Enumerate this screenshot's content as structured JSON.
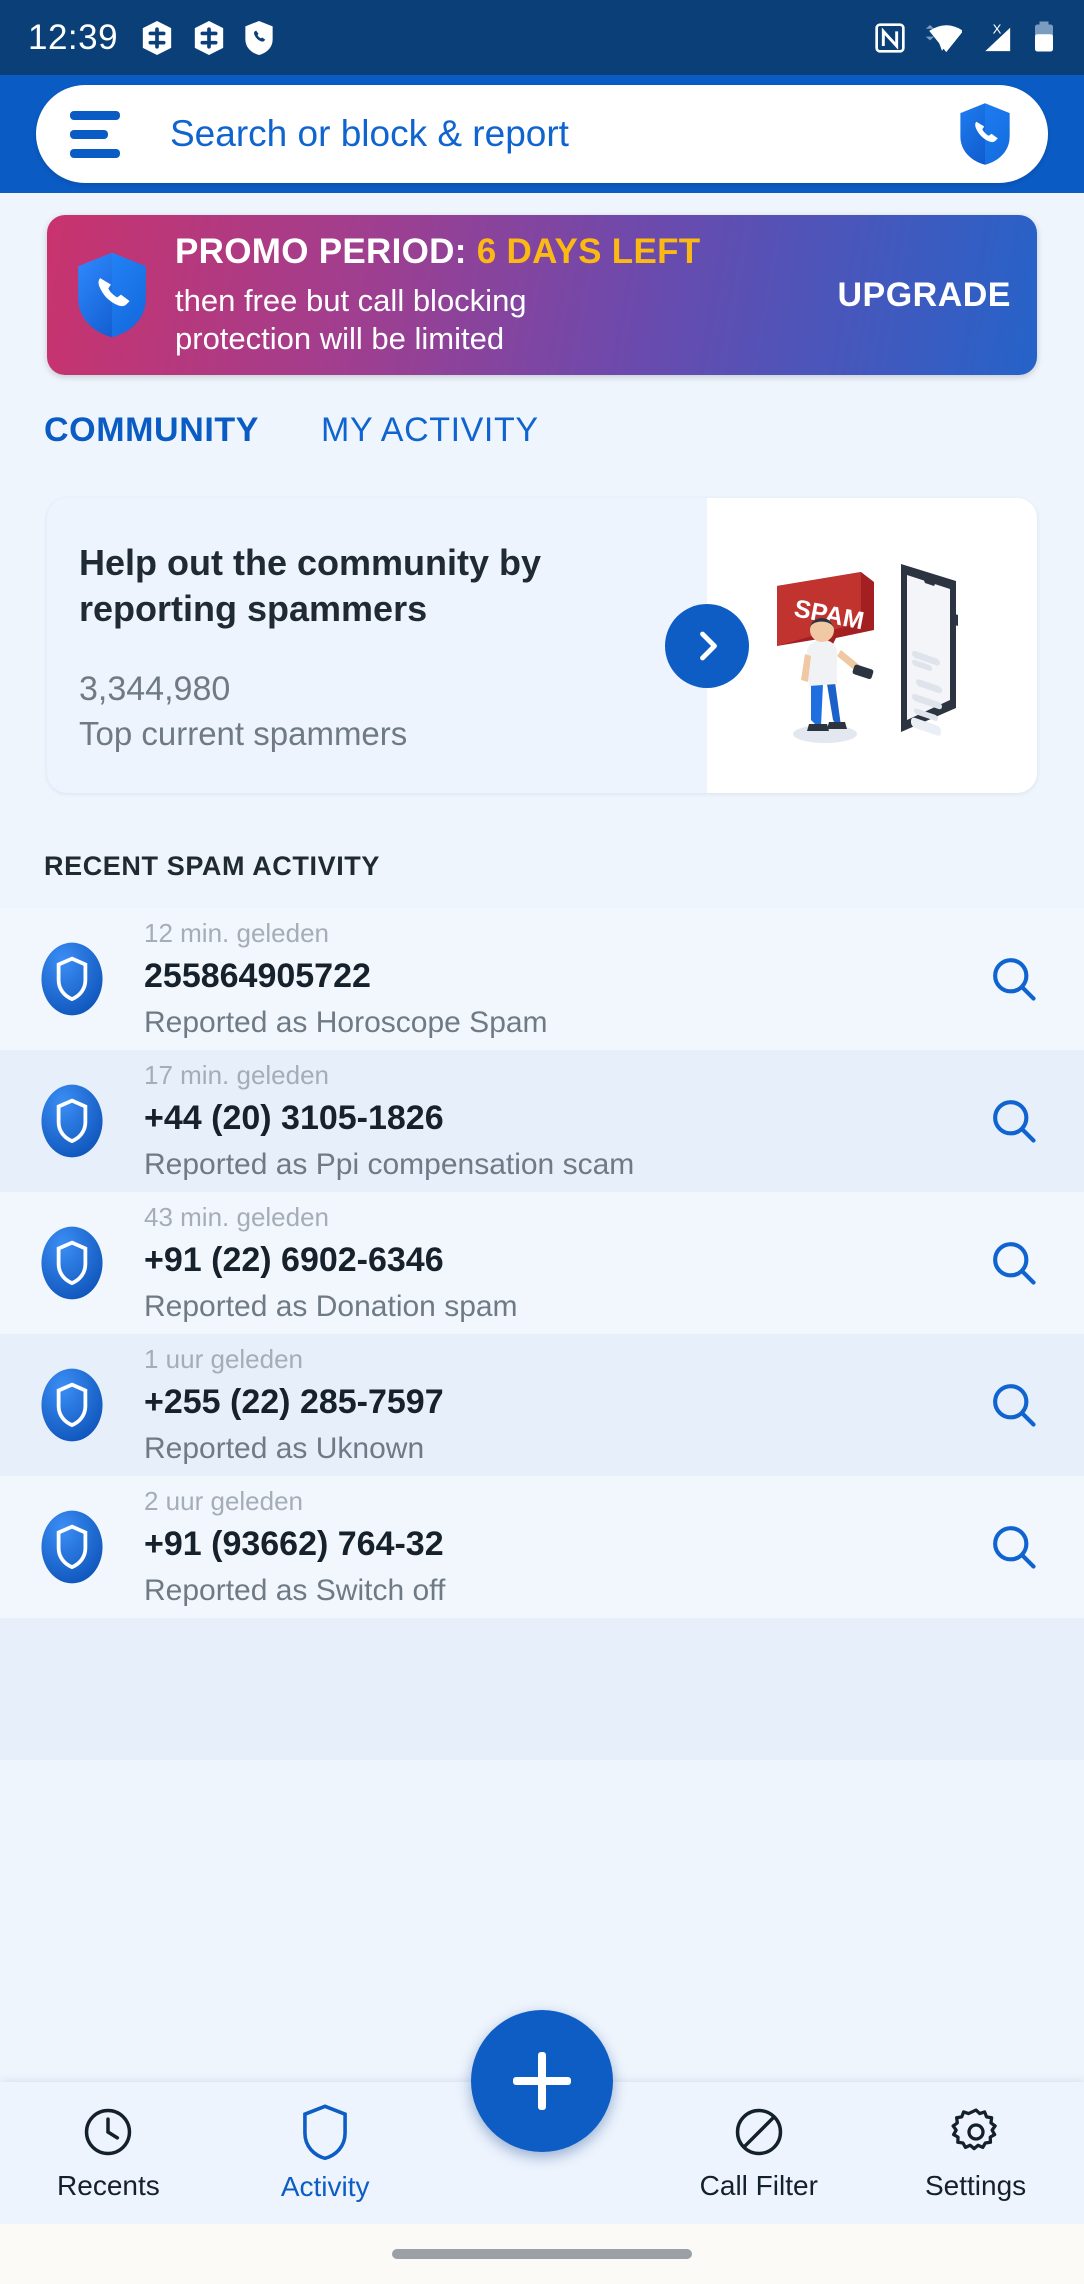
{
  "status_bar": {
    "time": "12:39",
    "left_icons": [
      "battery-saver-icon",
      "battery-saver-icon",
      "call-shield-icon"
    ],
    "right_icons": [
      "nfc-icon",
      "wifi-icon",
      "no-sim-signal-icon",
      "battery-icon"
    ]
  },
  "app_bar": {
    "menu_icon": "hamburger-menu-icon",
    "search_placeholder": "Search or block & report",
    "brand_icon": "call-shield-logo-icon"
  },
  "promo": {
    "label": "PROMO PERIOD:",
    "days_left": "6 DAYS LEFT",
    "sub_line1": "then free but call blocking",
    "sub_line2": "protection will be limited",
    "upgrade_label": "UPGRADE",
    "accent_color": "#fdb913",
    "gradient_from": "#c9336d",
    "gradient_to": "#2563c9"
  },
  "tabs": [
    {
      "label": "COMMUNITY",
      "active": true
    },
    {
      "label": "MY ACTIVITY",
      "active": false
    }
  ],
  "community_card": {
    "title_line1": "Help out the community by",
    "title_line2": "reporting spammers",
    "count": "3,344,980",
    "caption": "Top current spammers",
    "arrow_icon": "chevron-right-icon",
    "illustration_label": "SPAM"
  },
  "recent_activity": {
    "section_title": "RECENT SPAM ACTIVITY",
    "rows": [
      {
        "time": "12 min. geleden",
        "number": "255864905722",
        "reported": "Reported as Horoscope Spam"
      },
      {
        "time": "17 min. geleden",
        "number": "+44 (20) 3105-1826",
        "reported": "Reported as Ppi compensation scam"
      },
      {
        "time": "43 min. geleden",
        "number": "+91 (22) 6902-6346",
        "reported": "Reported as Donation spam"
      },
      {
        "time": "1 uur geleden",
        "number": "+255 (22) 285-7597",
        "reported": "Reported as Uknown"
      },
      {
        "time": "2 uur geleden",
        "number": "+91 (93662) 764-32",
        "reported": "Reported as Switch off"
      }
    ]
  },
  "fab": {
    "icon": "plus-icon"
  },
  "bottom_nav": [
    {
      "label": "Recents",
      "icon": "clock-icon",
      "active": false
    },
    {
      "label": "Activity",
      "icon": "shield-icon",
      "active": true
    },
    {
      "label": "Call Filter",
      "icon": "block-circle-icon",
      "active": false
    },
    {
      "label": "Settings",
      "icon": "gear-icon",
      "active": false
    }
  ],
  "colors": {
    "primary": "#0a5bc4",
    "status_bar": "#0a4077",
    "background": "#eff5fd"
  }
}
